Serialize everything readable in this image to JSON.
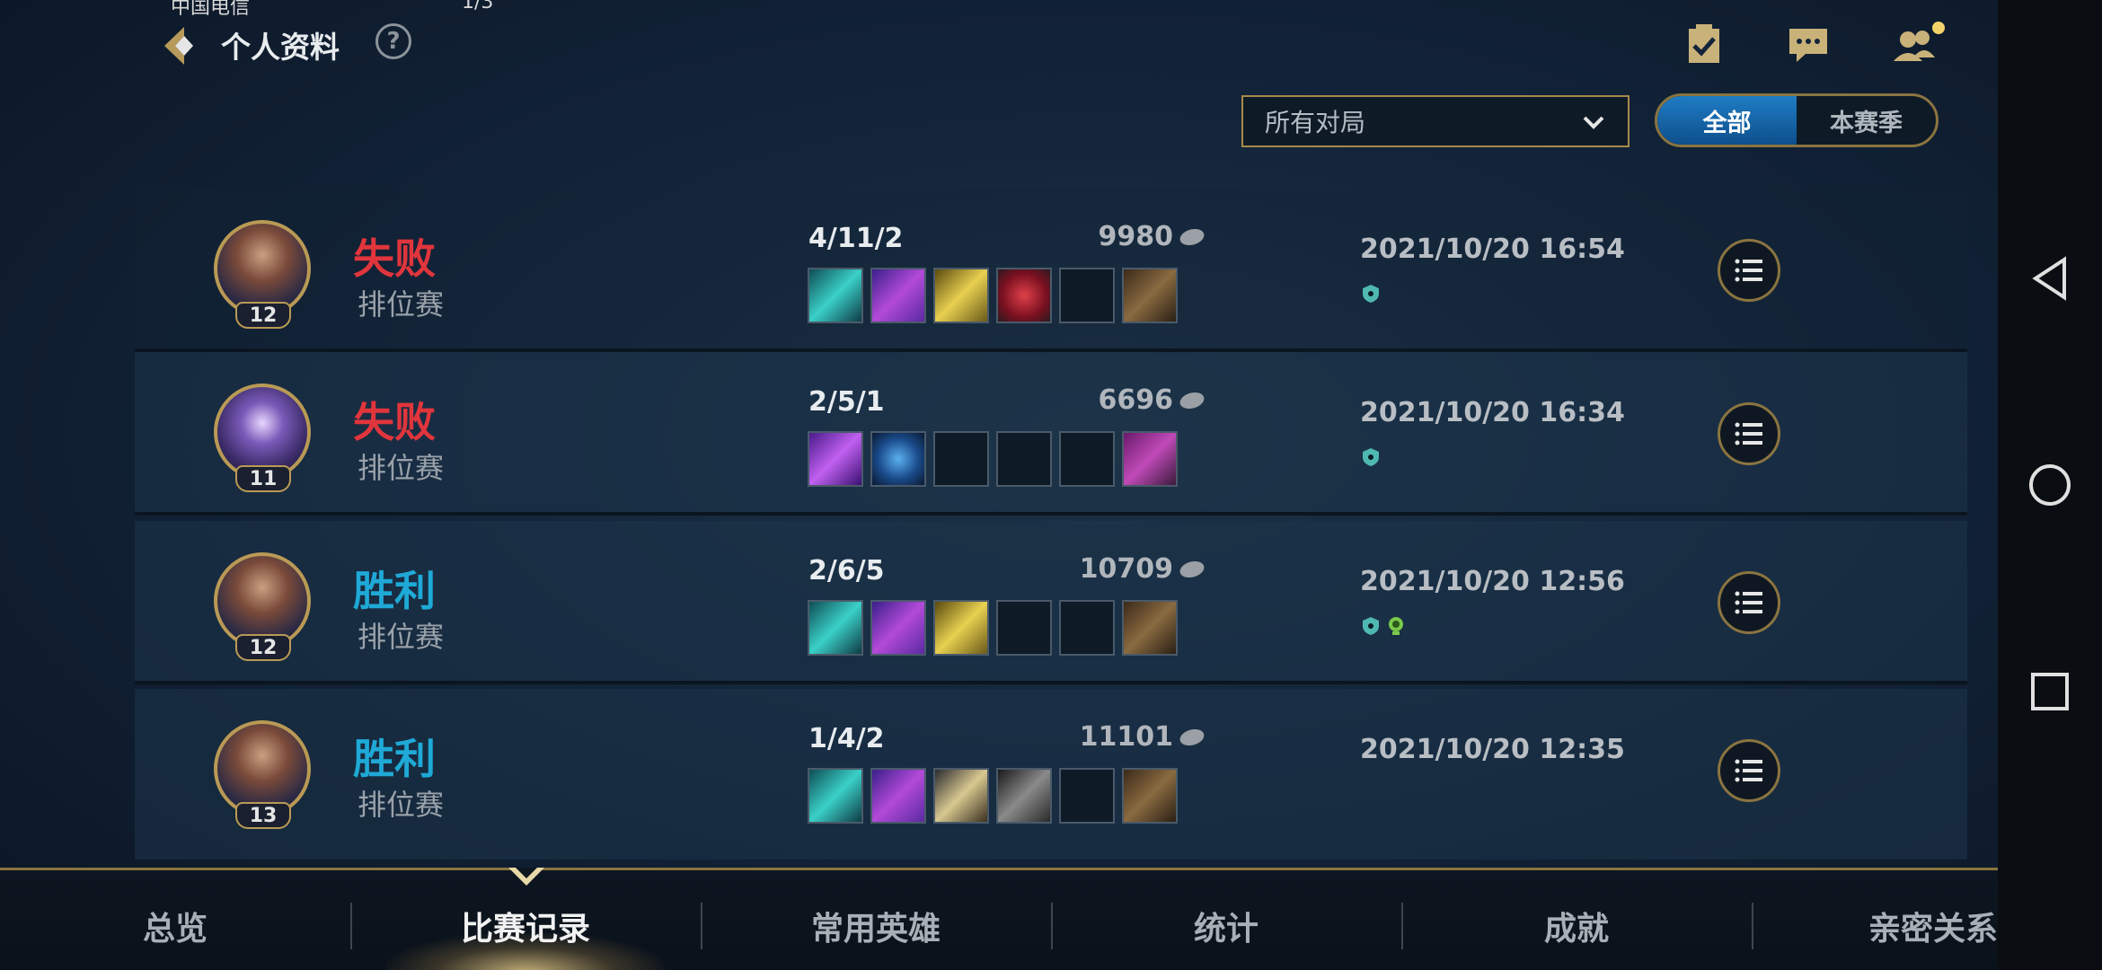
{
  "status": {
    "left": "中国电信",
    "mid": "1/3"
  },
  "header": {
    "title": "个人资料",
    "help": "?"
  },
  "filters": {
    "mode_dropdown": "所有对局",
    "scope_toggle": [
      "全部",
      "本赛季"
    ]
  },
  "matches": [
    {
      "level": "12",
      "result": "失败",
      "mode": "排位赛",
      "kda": "4/11/2",
      "gold": "9980",
      "time": "2021/10/20 16:54",
      "items": [
        "item-teal-blade",
        "item-purple-scythe",
        "item-gold-sword",
        "item-red-crystal",
        "",
        "item-boots"
      ]
    },
    {
      "level": "11",
      "result": "失败",
      "mode": "排位赛",
      "kda": "2/5/1",
      "gold": "6696",
      "time": "2021/10/20 16:34",
      "items": [
        "item-purple-staff",
        "item-blue-orb",
        "",
        "",
        "",
        "item-boots-purple"
      ]
    },
    {
      "level": "12",
      "result": "胜利",
      "mode": "排位赛",
      "kda": "2/6/5",
      "gold": "10709",
      "time": "2021/10/20 12:56",
      "items": [
        "item-teal-blade",
        "item-purple-scythe",
        "item-gold-sword",
        "",
        "",
        "item-boots"
      ]
    },
    {
      "level": "13",
      "result": "胜利",
      "mode": "排位赛",
      "kda": "1/4/2",
      "gold": "11101",
      "time": "2021/10/20 12:35",
      "items": [
        "item-teal-blade",
        "item-purple-scythe",
        "item-golden-spear",
        "item-dark-gauntlet",
        "",
        "item-boots"
      ]
    }
  ],
  "tabs": [
    "总览",
    "比赛记录",
    "常用英雄",
    "统计",
    "成就",
    "亲密关系"
  ],
  "active_tab": "比赛记录",
  "colors": {
    "lose": "#e0353c",
    "win": "#1fa9d6",
    "accent_gold": "#b99a55",
    "toggle_active": "#1f7cc4"
  }
}
